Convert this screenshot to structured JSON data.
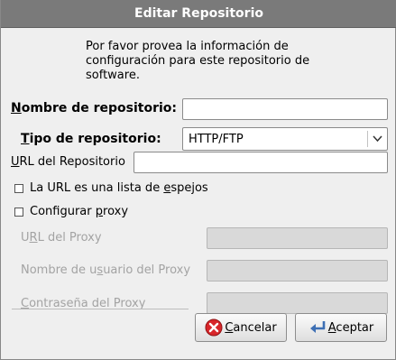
{
  "dialog": {
    "title": "Editar Repositorio",
    "intro": "Por favor provea la información de configuración para este repositorio de software."
  },
  "form": {
    "repo_name": {
      "label_u": "N",
      "label_rest": "ombre de repositorio:",
      "value": ""
    },
    "repo_type": {
      "label_u": "T",
      "label_rest": "ipo de repositorio:",
      "selected": "HTTP/FTP"
    },
    "repo_url": {
      "label_u": "U",
      "label_rest": "RL del Repositorio",
      "value": ""
    },
    "mirror_list": {
      "label_pre": "La URL es una lista de ",
      "label_u": "e",
      "label_post": "spejos",
      "checked": false
    },
    "proxy_config": {
      "label_pre": "Configurar ",
      "label_u": "p",
      "label_post": "roxy",
      "checked": false
    },
    "proxy_url": {
      "label_pre": "U",
      "label_u": "R",
      "label_post": "L del Proxy",
      "value": ""
    },
    "proxy_user": {
      "label_pre": "Nombre de u",
      "label_u": "s",
      "label_post": "uario del Proxy",
      "value": ""
    },
    "proxy_password": {
      "label_pre": "",
      "label_u": "C",
      "label_post": "ontraseña del Proxy",
      "value": ""
    }
  },
  "buttons": {
    "cancel": {
      "label_u": "C",
      "label_rest": "ancelar",
      "icon": "cancel-icon"
    },
    "ok": {
      "label_u": "A",
      "label_rest": "ceptar",
      "icon": "ok-icon"
    }
  },
  "colors": {
    "titlebar": "#7a7a7a",
    "background": "#efefef",
    "disabled_text": "#a3a3a3",
    "cancel_icon": "#d8262a",
    "ok_icon": "#3d6fb4"
  }
}
